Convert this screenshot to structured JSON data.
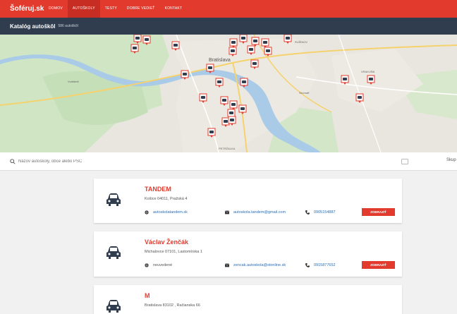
{
  "nav": {
    "brand": "Šoféruj.sk",
    "items": [
      {
        "label": "DOMOV"
      },
      {
        "label": "AUTOŠKOLY"
      },
      {
        "label": "TESTY"
      },
      {
        "label": "DOBRE VEDIEŤ"
      },
      {
        "label": "KONTAKT"
      }
    ]
  },
  "header": {
    "title": "Katalóg autoškôl",
    "count": "586 autoškôl"
  },
  "map": {
    "labels": [
      "Bratislava",
      "PETRŽALKA",
      "RUŽINOV",
      "VRAKUŇA",
      "Vodštedt",
      "Slovnaft"
    ]
  },
  "search": {
    "placeholder": "Názov autoškoly, obce alebo PSČ",
    "side_label": "Skup"
  },
  "schools": [
    {
      "name": "TANDEM",
      "address": "Košice 04011, Pražská 4",
      "web": "autoskolatandem.sk",
      "email": "autoskola.tandem@gmail.com",
      "phone": "0905154887",
      "button": "ZOBRAZIŤ PROFIL"
    },
    {
      "name": "Václav Ženčák",
      "address": "Michalovce 07101, Lastomírska 1",
      "web": "neuvedené",
      "email": "zencak.autoskola@stonline.sk",
      "phone": "0915877652",
      "button": "ZOBRAZIŤ PROFIL"
    },
    {
      "name": "M",
      "address": "Bratislava 83102 , Račianska 66"
    }
  ],
  "colors": {
    "brand_red": "#e23b2e",
    "header_dark": "#2f3d4f",
    "link_blue": "#2a6eb6"
  }
}
